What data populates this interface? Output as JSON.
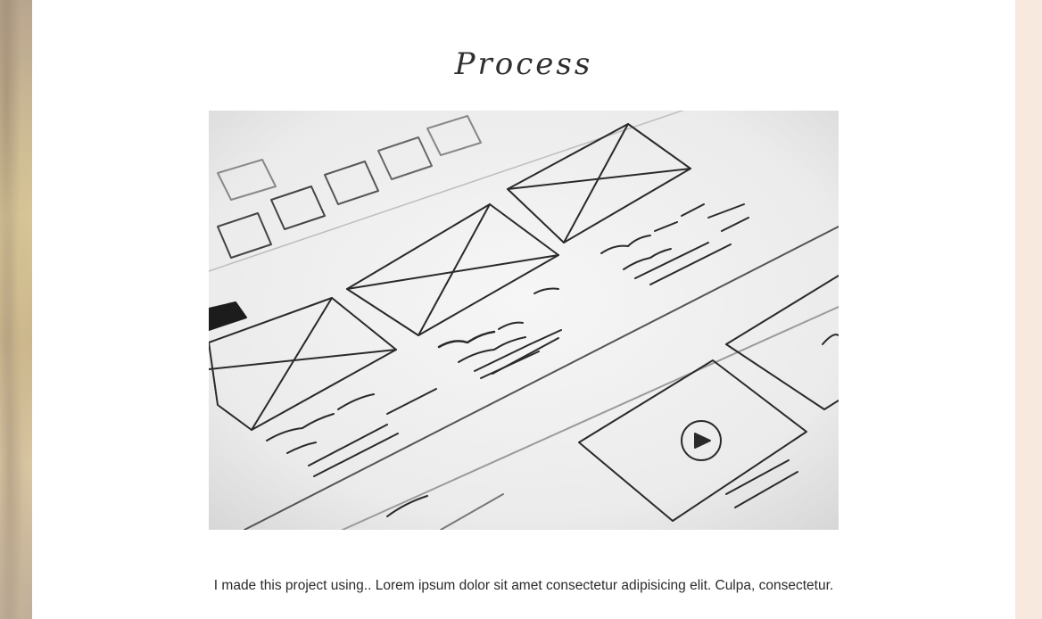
{
  "section": {
    "title": "Process",
    "caption": "I made this project using.. Lorem ipsum dolor sit amet consectetur adipisicing elit. Culpa, consectetur."
  },
  "image": {
    "subject": "wireframe-sketch-photo",
    "colors": {
      "paper": "#f1f1f1",
      "ink": "#2a2a2a"
    }
  },
  "colors": {
    "card": "#ffffff",
    "page_background": "#f7ebe2",
    "text": "#2b2b2b"
  }
}
